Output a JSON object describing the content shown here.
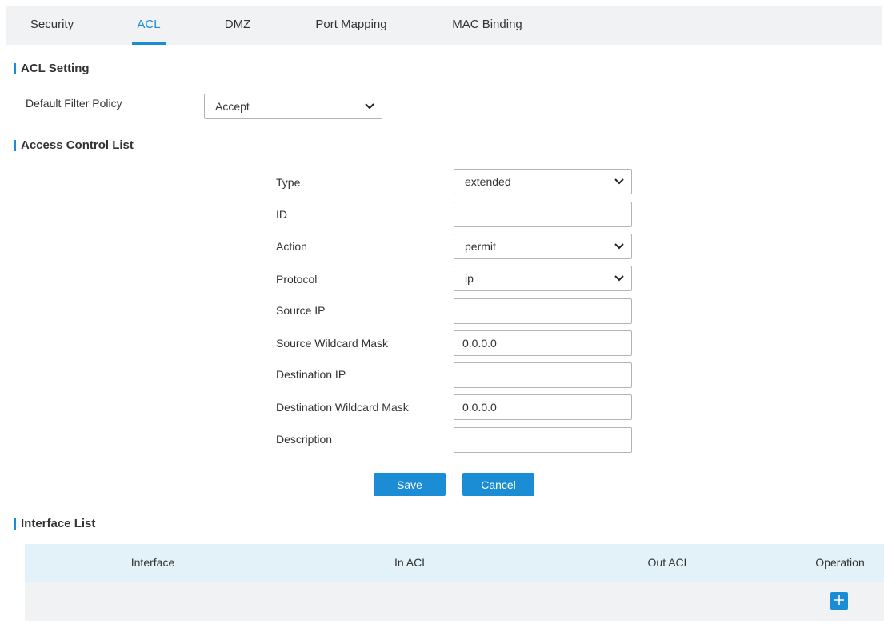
{
  "tabs": [
    {
      "label": "Security",
      "active": false
    },
    {
      "label": "ACL",
      "active": true
    },
    {
      "label": "DMZ",
      "active": false
    },
    {
      "label": "Port Mapping",
      "active": false
    },
    {
      "label": "MAC Binding",
      "active": false
    }
  ],
  "acl_setting": {
    "title": "ACL Setting",
    "default_filter_policy_label": "Default Filter Policy",
    "default_filter_policy_value": "Accept"
  },
  "access_control_list": {
    "title": "Access Control List",
    "fields": {
      "type": {
        "label": "Type",
        "value": "extended"
      },
      "id": {
        "label": "ID",
        "value": ""
      },
      "action": {
        "label": "Action",
        "value": "permit"
      },
      "protocol": {
        "label": "Protocol",
        "value": "ip"
      },
      "source_ip": {
        "label": "Source IP",
        "value": ""
      },
      "source_wildcard_mask": {
        "label": "Source Wildcard Mask",
        "value": "0.0.0.0"
      },
      "destination_ip": {
        "label": "Destination IP",
        "value": ""
      },
      "destination_wildcard_mask": {
        "label": "Destination Wildcard Mask",
        "value": "0.0.0.0"
      },
      "description": {
        "label": "Description",
        "value": ""
      }
    },
    "save_label": "Save",
    "cancel_label": "Cancel"
  },
  "interface_list": {
    "title": "Interface List",
    "columns": [
      "Interface",
      "In ACL",
      "Out ACL",
      "Operation"
    ]
  },
  "colors": {
    "accent": "#1a8dd4",
    "tab_bg": "#f0f2f3",
    "table_header_bg": "#e3f1f8"
  },
  "icons": {
    "dropdown": "chevron-down-icon",
    "add": "plus-icon"
  }
}
